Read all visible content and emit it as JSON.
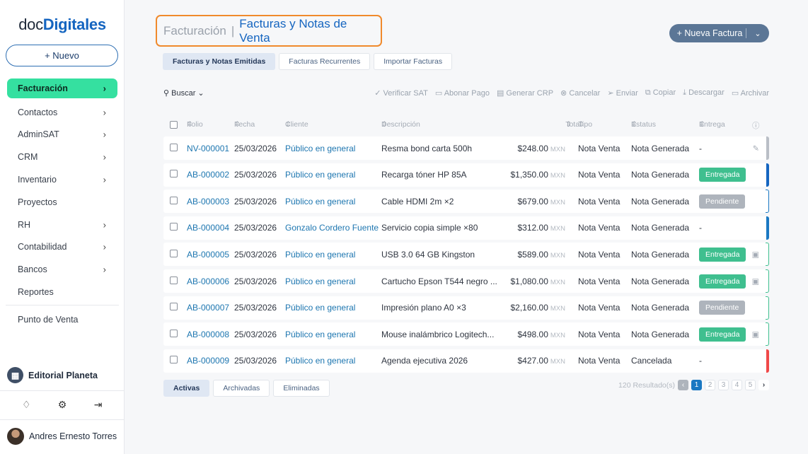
{
  "brand": {
    "logo_prefix": "doc",
    "logo_bold": "Digitales",
    "accent": "#1565c0",
    "active_nav": "#35e0a0"
  },
  "sidebar": {
    "new_label": "+ Nuevo",
    "items": [
      {
        "label": "Facturación",
        "chevron": true
      },
      {
        "label": "Contactos",
        "chevron": true
      },
      {
        "label": "AdminSAT",
        "chevron": true
      },
      {
        "label": "CRM",
        "chevron": true
      },
      {
        "label": "Inventario",
        "chevron": true
      },
      {
        "label": "Proyectos",
        "chevron": false
      },
      {
        "label": "RH",
        "chevron": true
      },
      {
        "label": "Contabilidad",
        "chevron": true
      },
      {
        "label": "Bancos",
        "chevron": true
      },
      {
        "label": "Reportes",
        "chevron": false
      },
      {
        "label": "Punto de Venta",
        "chevron": false
      }
    ],
    "org": "Editorial Planeta",
    "user": "Andres Ernesto Torres"
  },
  "header": {
    "crumb": "Facturación",
    "separator": "|",
    "current": "Facturas y Notas de Venta",
    "add_label": "+ Nueva Factura"
  },
  "tabs": [
    "Facturas y Notas Emitidas",
    "Facturas Recurrentes",
    "Importar Facturas"
  ],
  "toolbar": {
    "search": "Buscar",
    "actions": [
      "Verificar SAT",
      "Abonar Pago",
      "Generar CRP",
      "Cancelar",
      "Enviar",
      "Copiar",
      "Descargar",
      "Archivar"
    ]
  },
  "columns": {
    "folio": "Folio",
    "fecha": "Fecha",
    "cliente": "Cliente",
    "descripcion": "Descripción",
    "total": "Total",
    "tipo": "Tipo",
    "estatus": "Estatus",
    "entrega": "Entrega"
  },
  "rows": [
    {
      "folio": "NV-000001",
      "fecha": "25/03/2026",
      "cliente": "Público en general",
      "descripcion": "Resma bond carta 500h",
      "total": "$248.00",
      "currency": "MXN",
      "tipo": "Nota Venta",
      "estatus": "Nota Generada",
      "entrega": "-",
      "bar": "#b9bec6",
      "icon": "✎"
    },
    {
      "folio": "AB-000002",
      "fecha": "25/03/2026",
      "cliente": "Público en general",
      "descripcion": "Recarga tóner HP 85A",
      "total": "$1,350.00",
      "currency": "MXN",
      "tipo": "Nota Venta",
      "estatus": "Nota Generada",
      "entrega": "Entregada",
      "bar": "#1565c0",
      "icon": ""
    },
    {
      "folio": "AB-000003",
      "fecha": "25/03/2026",
      "cliente": "Público en general",
      "descripcion": "Cable HDMI 2m ×2",
      "total": "$679.00",
      "currency": "MXN",
      "tipo": "Nota Venta",
      "estatus": "Nota Generada",
      "entrega": "Pendiente",
      "bar": "outline:#1a78c2",
      "icon": ""
    },
    {
      "folio": "AB-000004",
      "fecha": "25/03/2026",
      "cliente": "Gonzalo Cordero Fuente",
      "descripcion": "Servicio copia simple ×80",
      "total": "$312.00",
      "currency": "MXN",
      "tipo": "Nota Venta",
      "estatus": "Nota Generada",
      "entrega": "-",
      "bar": "#1a78c2",
      "icon": ""
    },
    {
      "folio": "AB-000005",
      "fecha": "25/03/2026",
      "cliente": "Público en general",
      "descripcion": "USB 3.0 64 GB Kingston",
      "total": "$589.00",
      "currency": "MXN",
      "tipo": "Nota Venta",
      "estatus": "Nota Generada",
      "entrega": "Entregada",
      "bar": "outline:#3fbf8f",
      "icon": "▣"
    },
    {
      "folio": "AB-000006",
      "fecha": "25/03/2026",
      "cliente": "Público en general",
      "descripcion": "Cartucho Epson T544 negro ...",
      "total": "$1,080.00",
      "currency": "MXN",
      "tipo": "Nota Venta",
      "estatus": "Nota Generada",
      "entrega": "Entregada",
      "bar": "outline:#3fbf8f",
      "icon": "▣"
    },
    {
      "folio": "AB-000007",
      "fecha": "25/03/2026",
      "cliente": "Público en general",
      "descripcion": "Impresión plano A0 ×3",
      "total": "$2,160.00",
      "currency": "MXN",
      "tipo": "Nota Venta",
      "estatus": "Nota Generada",
      "entrega": "Pendiente",
      "bar": "outline:#3fbf8f",
      "icon": ""
    },
    {
      "folio": "AB-000008",
      "fecha": "25/03/2026",
      "cliente": "Público en general",
      "descripcion": "Mouse inalámbrico Logitech...",
      "total": "$498.00",
      "currency": "MXN",
      "tipo": "Nota Venta",
      "estatus": "Nota Generada",
      "entrega": "Entregada",
      "bar": "outline:#3fbf8f",
      "icon": "▣"
    },
    {
      "folio": "AB-000009",
      "fecha": "25/03/2026",
      "cliente": "Público en general",
      "descripcion": "Agenda ejecutiva 2026",
      "total": "$427.00",
      "currency": "MXN",
      "tipo": "Nota Venta",
      "estatus": "Cancelada",
      "entrega": "-",
      "bar": "#f04848",
      "icon": ""
    }
  ],
  "bottom_tabs": [
    "Activas",
    "Archivadas",
    "Eliminadas"
  ],
  "pager": {
    "results": "120 Resultado(s)",
    "pages": [
      "1",
      "2",
      "3",
      "4",
      "5"
    ],
    "current": "1"
  }
}
